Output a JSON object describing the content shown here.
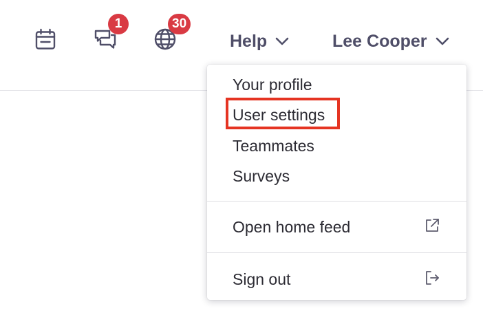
{
  "header": {
    "icons": {
      "calendar": "calendar-icon",
      "messages": "chat-bubbles-icon",
      "globe": "globe-icon"
    },
    "messages_badge": "1",
    "globe_badge": "30",
    "help_label": "Help",
    "user_name": "Lee Cooper"
  },
  "user_menu": {
    "items": [
      {
        "label": "Your profile"
      },
      {
        "label": "User settings",
        "highlighted": true
      },
      {
        "label": "Teammates"
      },
      {
        "label": "Surveys"
      },
      {
        "label": "Open home feed",
        "icon": "external-link-icon"
      },
      {
        "label": "Sign out",
        "icon": "sign-out-icon"
      }
    ]
  },
  "colors": {
    "badge": "#d93a43",
    "header_text": "#4f4e68",
    "highlight_box": "#e53422"
  }
}
